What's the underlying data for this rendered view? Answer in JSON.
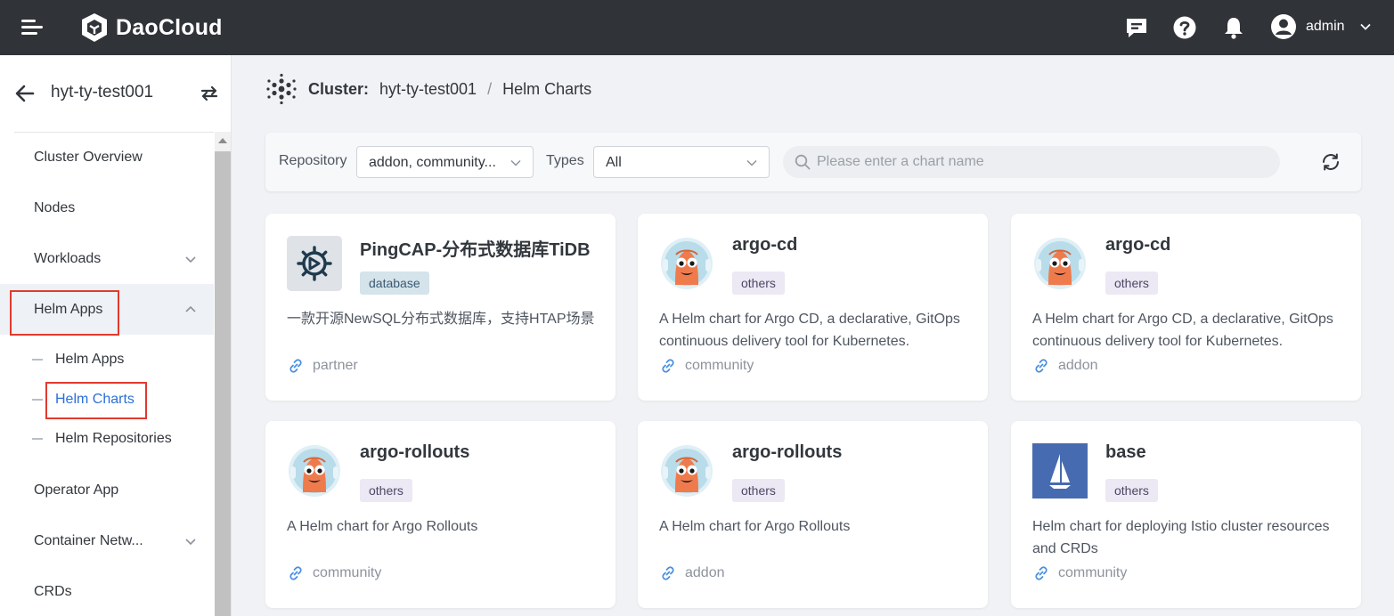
{
  "app": {
    "logo_text": "DaoCloud",
    "user_name": "admin"
  },
  "sidebar": {
    "cluster_name": "hyt-ty-test001",
    "items": [
      {
        "label": "Cluster Overview"
      },
      {
        "label": "Nodes"
      },
      {
        "label": "Workloads"
      },
      {
        "label": "Helm Apps"
      },
      {
        "label": "Operator App"
      },
      {
        "label": "Container Netw..."
      },
      {
        "label": "CRDs"
      }
    ],
    "helm_sub": [
      {
        "label": "Helm Apps"
      },
      {
        "label": "Helm Charts"
      },
      {
        "label": "Helm Repositories"
      }
    ]
  },
  "breadcrumb": {
    "key": "Cluster:",
    "cluster": "hyt-ty-test001",
    "separator": "/",
    "page": "Helm Charts"
  },
  "filters": {
    "repository_label": "Repository",
    "repository_value": "addon, community...",
    "types_label": "Types",
    "types_value": "All",
    "search_placeholder": "Please enter a chart name"
  },
  "charts": [
    {
      "name": "PingCAP-分布式数据库TiDB",
      "tag": "database",
      "description": "一款开源NewSQL分布式数据库，支持HTAP场景",
      "repo": "partner",
      "icon": "gear-icon"
    },
    {
      "name": "argo-cd",
      "tag": "others",
      "description": "A Helm chart for Argo CD, a declarative, GitOps continuous delivery tool for Kubernetes.",
      "repo": "community",
      "icon": "argo-icon"
    },
    {
      "name": "argo-cd",
      "tag": "others",
      "description": "A Helm chart for Argo CD, a declarative, GitOps continuous delivery tool for Kubernetes.",
      "repo": "addon",
      "icon": "argo-icon"
    },
    {
      "name": "argo-rollouts",
      "tag": "others",
      "description": "A Helm chart for Argo Rollouts",
      "repo": "community",
      "icon": "argo-icon"
    },
    {
      "name": "argo-rollouts",
      "tag": "others",
      "description": "A Helm chart for Argo Rollouts",
      "repo": "addon",
      "icon": "argo-icon"
    },
    {
      "name": "base",
      "tag": "others",
      "description": "Helm chart for deploying Istio cluster resources and CRDs",
      "repo": "community",
      "icon": "istio-icon"
    }
  ],
  "colors": {
    "topbar": "#303338",
    "accent": "#2b6fd8",
    "highlight": "#e03a2e"
  }
}
